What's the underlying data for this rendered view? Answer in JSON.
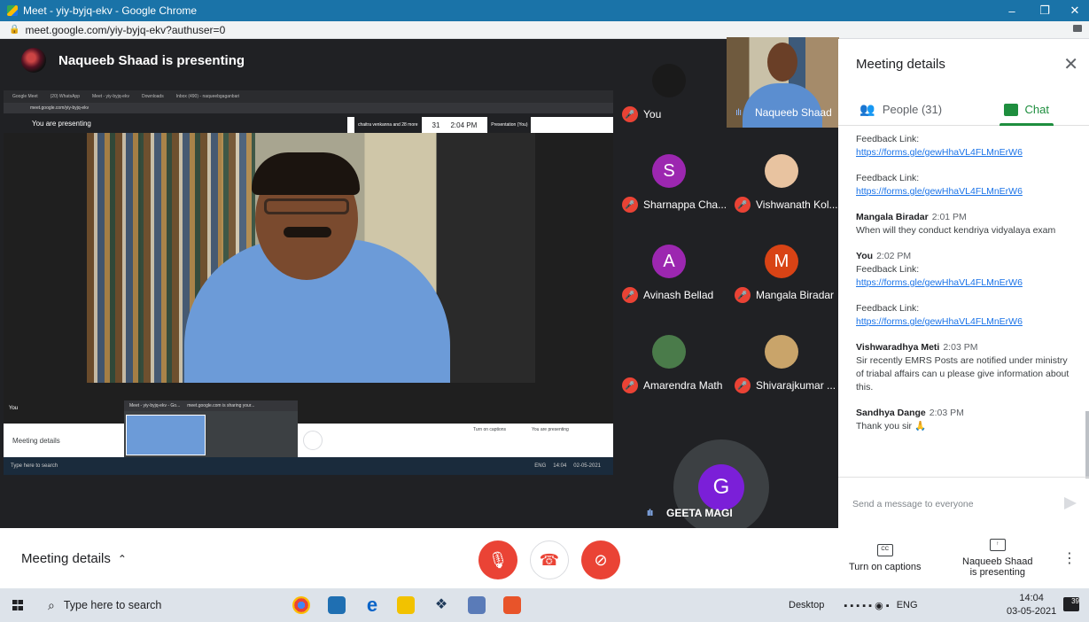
{
  "window": {
    "title": "Meet - yiy-byjq-ekv - Google Chrome",
    "url": "meet.google.com/yiy-byjq-ekv?authuser=0"
  },
  "stage": {
    "presenter_label": "Naqueeb Shaad is presenting"
  },
  "shared_screen": {
    "tabs": [
      "Google Meet",
      "(20) WhatsApp",
      "Meet - yiy-byjq-ekv",
      "Downloads",
      "Inbox (490) - naqueebgaganbari"
    ],
    "url": "meet.google.com/yiy-byjq-ekv",
    "present_label": "You are presenting",
    "toolbar_names": "chaitra venkanna and 28 more",
    "toolbar_count": "31",
    "toolbar_time": "2:04 PM",
    "toolbar_presentation": "Presentation (You)",
    "self_label": "You",
    "meeting_details": "Meeting details",
    "popup_tab1": "Meet - yiy-byjq-ekv - Go...",
    "popup_tab2": "meet.google.com is sharing your...",
    "captions": "Turn on captions",
    "presenting": "You are presenting",
    "taskbar_search": "Type here to search",
    "taskbar_lang": "ENG",
    "taskbar_time": "14:04",
    "taskbar_date": "02-05-2021"
  },
  "participants": [
    {
      "name": "You",
      "initial": "",
      "color": "",
      "muted": true
    },
    {
      "name": "Naqueeb Shaad",
      "initial": "",
      "color": "",
      "muted": false
    },
    {
      "name": "Sharnappa Cha...",
      "initial": "S",
      "color": "#9c27b0",
      "muted": true
    },
    {
      "name": "Vishwanath Kol...",
      "initial": "",
      "color": "#e8c3a0",
      "muted": true
    },
    {
      "name": "Avinash Bellad",
      "initial": "A",
      "color": "#9c27b0",
      "muted": true
    },
    {
      "name": "Mangala Biradar",
      "initial": "M",
      "color": "#d84315",
      "muted": true
    },
    {
      "name": "Amarendra Math",
      "initial": "",
      "color": "#4a7b4a",
      "muted": true
    },
    {
      "name": "Shivarajkumar ...",
      "initial": "",
      "color": "#c9a46a",
      "muted": true
    }
  ],
  "speaker": {
    "name": "GEETA MAGI",
    "initial": "G"
  },
  "panel": {
    "title": "Meeting details",
    "tab_people": "People (31)",
    "tab_chat": "Chat",
    "messages": [
      {
        "sender": "",
        "time": "",
        "text": "Feedback Link:",
        "link": "https://forms.gle/gewHhaVL4FLMnErW6"
      },
      {
        "sender": "",
        "time": "",
        "text": "Feedback Link:",
        "link": "https://forms.gle/gewHhaVL4FLMnErW6"
      },
      {
        "sender": "Mangala Biradar",
        "time": "2:01 PM",
        "text": "When will they conduct kendriya vidyalaya exam",
        "link": ""
      },
      {
        "sender": "You",
        "time": "2:02 PM",
        "text": "Feedback Link:",
        "link": "https://forms.gle/gewHhaVL4FLMnErW6"
      },
      {
        "sender": "",
        "time": "",
        "text": "Feedback Link:",
        "link": "https://forms.gle/gewHhaVL4FLMnErW6"
      },
      {
        "sender": "Vishwaradhya Meti",
        "time": "2:03 PM",
        "text": "Sir recently EMRS Posts are notified under ministry of triabal affairs can u please give information about this.",
        "link": ""
      },
      {
        "sender": "Sandhya Dange",
        "time": "2:03 PM",
        "text": "Thank you sir 🙏",
        "link": ""
      }
    ],
    "input_placeholder": "Send a message to everyone"
  },
  "bottom": {
    "meeting_details": "Meeting details",
    "captions": "Turn on captions",
    "presenting_line1": "Naqueeb Shaad",
    "presenting_line2": "is presenting"
  },
  "taskbar": {
    "search_placeholder": "Type here to search",
    "desktop": "Desktop",
    "lang": "ENG",
    "time": "14:04",
    "date": "03-05-2021",
    "notifications": "39"
  }
}
